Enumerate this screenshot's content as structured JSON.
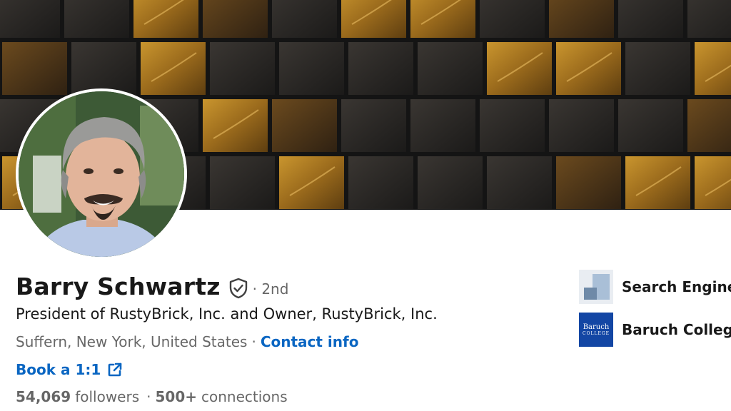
{
  "profile": {
    "name": "Barry Schwartz",
    "degree": "· 2nd",
    "headline": "President of RustyBrick, Inc. and Owner, RustyBrick, Inc.",
    "location": "Suffern, New York, United States",
    "location_separator": "·",
    "contact_label": "Contact info",
    "book_label": "Book a 1:1",
    "followers_count": "54,069",
    "followers_label": "followers",
    "stats_separator": "·",
    "connections_count": "500+",
    "connections_label": "connections"
  },
  "sidebar": {
    "organizations": [
      {
        "name": "Search Engine La",
        "logo": "search-engine-land-logo"
      },
      {
        "name": "Baruch College",
        "logo": "baruch-college-logo",
        "logo_text": "Baruch",
        "logo_subtext": "COLLEGE"
      }
    ]
  },
  "colors": {
    "link": "#0a66c2",
    "baruch_blue": "#1346a4",
    "banner_gold": "#b5801f"
  },
  "icons": {
    "verified": "shield-check-icon",
    "external_link": "external-link-icon"
  }
}
